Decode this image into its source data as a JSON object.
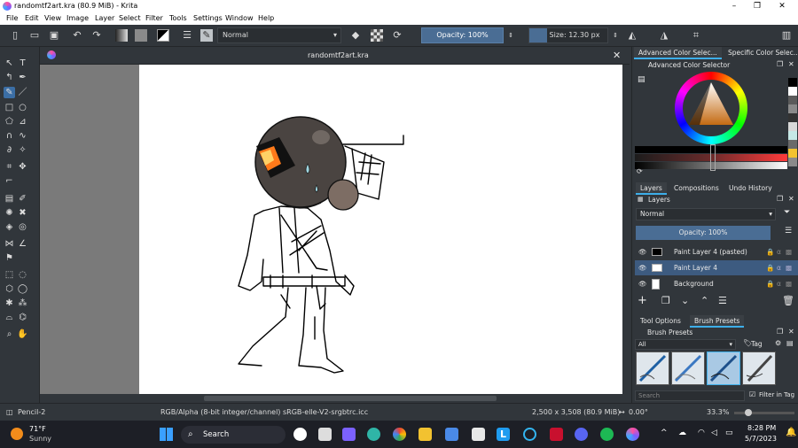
{
  "window": {
    "title": "randomtf2art.kra (80.9 MiB)  - Krita",
    "minimize": "–",
    "maximize": "❐",
    "close": "✕"
  },
  "menu": [
    "File",
    "Edit",
    "View",
    "Image",
    "Layer",
    "Select",
    "Filter",
    "Tools",
    "Settings",
    "Window",
    "Help"
  ],
  "toolbar": {
    "blend_mode": "Normal",
    "opacity": "Opacity: 100%",
    "size": "Size: 12.30 px"
  },
  "document": {
    "tab_title": "randomtf2art.kra",
    "close": "✕"
  },
  "dock": {
    "top_tabs": [
      "Advanced Color Selec...",
      "Specific Color Selec..."
    ],
    "color_selector_title": "Advanced Color Selector",
    "mid_tabs": [
      "Layers",
      "Compositions",
      "Undo History"
    ],
    "layers_title": "Layers",
    "blend": "Normal",
    "opacity": "Opacity:  100%",
    "layers": [
      {
        "name": "Paint Layer 4 (pasted)"
      },
      {
        "name": "Paint Layer 4"
      },
      {
        "name": "Background"
      }
    ],
    "bottom_tabs": [
      "Tool Options",
      "Brush Presets"
    ],
    "brush_presets_title": "Brush Presets",
    "preset_filter": "All",
    "tag_label": "Tag",
    "search_placeholder": "Search",
    "filter_in_tag": "Filter in Tag"
  },
  "status": {
    "brush": "Pencil-2",
    "color_model": "RGB/Alpha (8-bit integer/channel)  sRGB-elle-V2-srgbtrc.icc",
    "dimensions": "2,500 x 3,508 (80.9 MiB)",
    "rotation": "0.00°",
    "zoom": "33.3%"
  },
  "taskbar": {
    "weather_temp": "71°F",
    "weather_desc": "Sunny",
    "search": "Search",
    "time": "8:28 PM",
    "date": "5/7/2023"
  },
  "colors": {
    "accent": "#3daee9",
    "selection": "#3d5b80",
    "opacity_bar": "#4a6d94"
  }
}
